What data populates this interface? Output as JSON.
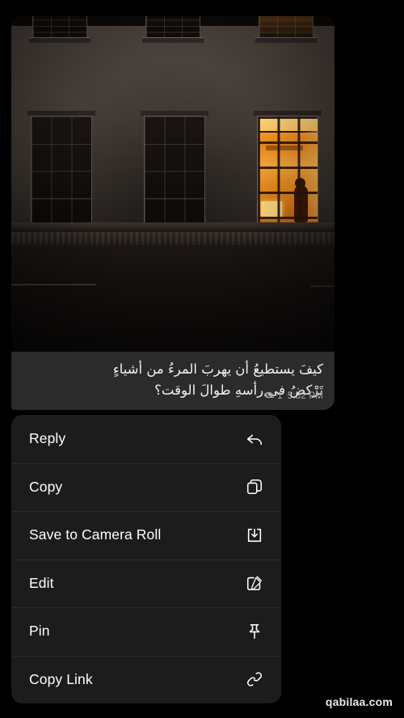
{
  "app": {
    "background_color": "#000000",
    "theme": "dark"
  },
  "message": {
    "bubble_color": "#2b2b2b",
    "photo": {
      "icon_name": "photo-attachment",
      "description": "Night photo of a building facade with three windows; the right-hand window is lit warm orange with a silhouetted person at a desk"
    },
    "caption": "كيفَ يستطيعُ أن يهربَ المرءُ من أشياءٍ\nتَرْكضُ في رأسهِ طوالَ الوقت؟",
    "views": "1",
    "timestamp": "5:32 PM",
    "views_icon_name": "eye-icon"
  },
  "context_menu": {
    "background_color": "#1c1c1c",
    "items": [
      {
        "label": "Reply",
        "icon": "reply-arrow-icon"
      },
      {
        "label": "Copy",
        "icon": "copy-icon"
      },
      {
        "label": "Save to Camera Roll",
        "icon": "download-icon"
      },
      {
        "label": "Edit",
        "icon": "pencil-square-icon"
      },
      {
        "label": "Pin",
        "icon": "pin-icon"
      },
      {
        "label": "Copy Link",
        "icon": "link-icon"
      }
    ]
  },
  "watermark": {
    "text": "qabilaa.com"
  }
}
